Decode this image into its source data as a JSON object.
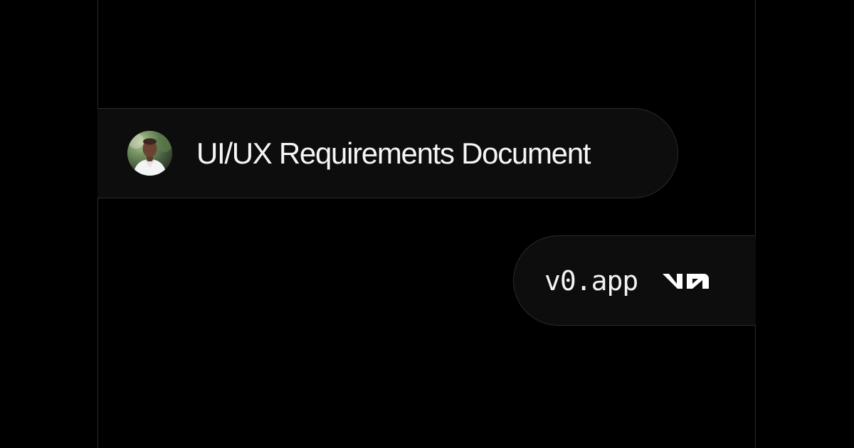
{
  "card": {
    "title": "UI/UX Requirements  Document",
    "avatar_icon": "avatar-portrait-icon"
  },
  "brand": {
    "domain": "v0.app",
    "logo_icon": "v0-logo-icon"
  },
  "colors": {
    "background": "#000000",
    "bubble": "#0d0d0d",
    "bubble_border": "#2b2b2b",
    "guide_line": "#2a2a2a",
    "text": "#f5f5f5"
  }
}
